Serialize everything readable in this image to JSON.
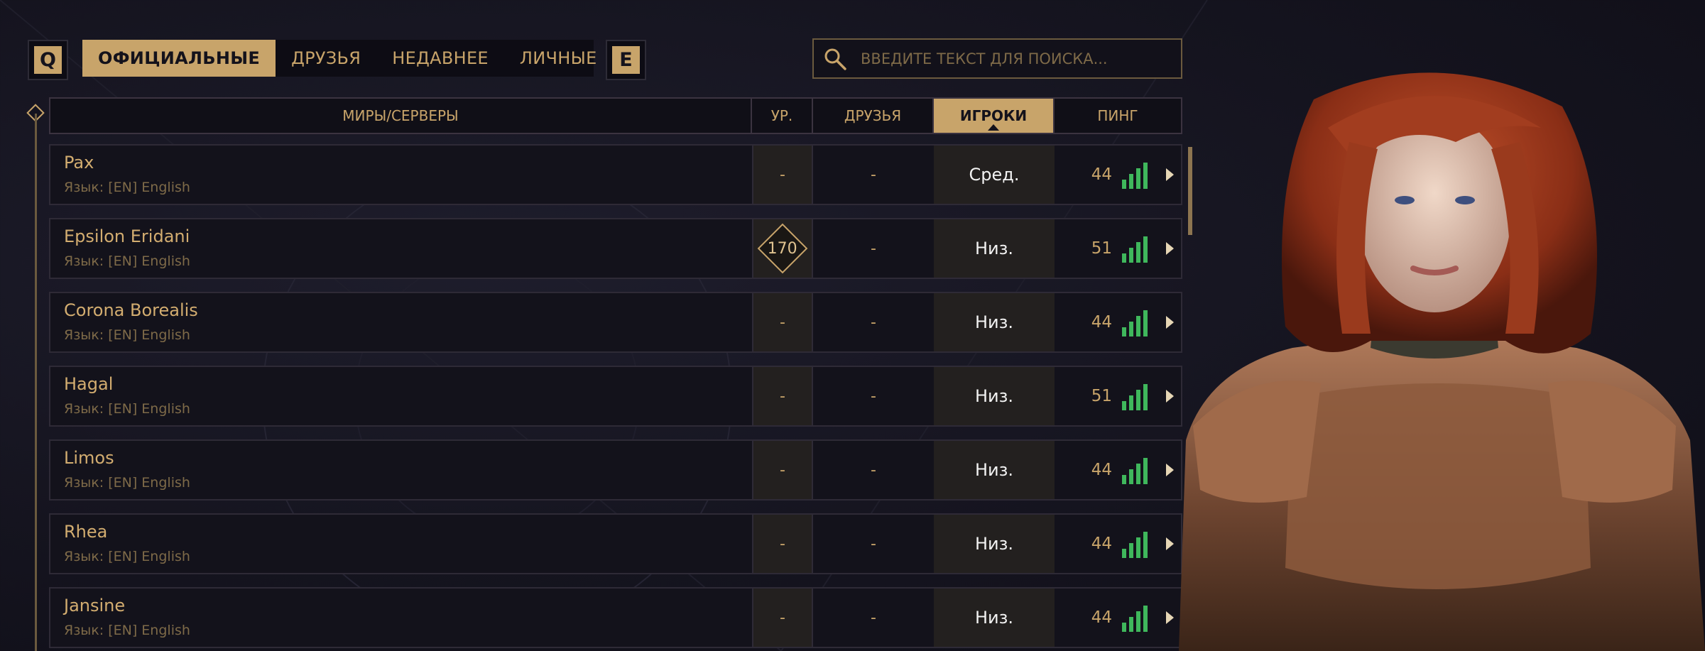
{
  "keys": {
    "left": "Q",
    "right": "E"
  },
  "tabs": [
    {
      "label": "ОФИЦИАЛЬНЫЕ",
      "active": true
    },
    {
      "label": "ДРУЗЬЯ",
      "active": false
    },
    {
      "label": "НЕДАВНЕЕ",
      "active": false
    },
    {
      "label": "ЛИЧНЫЕ",
      "active": false
    }
  ],
  "search": {
    "placeholder": "ВВЕДИТЕ ТЕКСТ ДЛЯ ПОИСКА...",
    "value": "",
    "icon": "search-icon"
  },
  "columns": {
    "worlds": "МИРЫ/СЕРВЕРЫ",
    "level": "УР.",
    "friends": "ДРУЗЬЯ",
    "players": "ИГРОКИ",
    "ping": "ПИНГ",
    "sorted_by": "players"
  },
  "servers": [
    {
      "name": "Pax",
      "lang": "Язык: [EN] English",
      "level": "-",
      "friends": "-",
      "players": "Сред.",
      "ping": "44",
      "signal_bars": 4
    },
    {
      "name": "Epsilon Eridani",
      "lang": "Язык: [EN] English",
      "level": "170",
      "friends": "-",
      "players": "Низ.",
      "ping": "51",
      "signal_bars": 4
    },
    {
      "name": "Corona Borealis",
      "lang": "Язык: [EN] English",
      "level": "-",
      "friends": "-",
      "players": "Низ.",
      "ping": "44",
      "signal_bars": 4
    },
    {
      "name": "Hagal",
      "lang": "Язык: [EN] English",
      "level": "-",
      "friends": "-",
      "players": "Низ.",
      "ping": "51",
      "signal_bars": 4
    },
    {
      "name": "Limos",
      "lang": "Язык: [EN] English",
      "level": "-",
      "friends": "-",
      "players": "Низ.",
      "ping": "44",
      "signal_bars": 4
    },
    {
      "name": "Rhea",
      "lang": "Язык: [EN] English",
      "level": "-",
      "friends": "-",
      "players": "Низ.",
      "ping": "44",
      "signal_bars": 4
    },
    {
      "name": "Jansine",
      "lang": "Язык: [EN] English",
      "level": "-",
      "friends": "-",
      "players": "Низ.",
      "ping": "44",
      "signal_bars": 4
    }
  ],
  "colors": {
    "accent": "#c8a46a",
    "signal": "#3fb75c",
    "background": "#15141f"
  }
}
